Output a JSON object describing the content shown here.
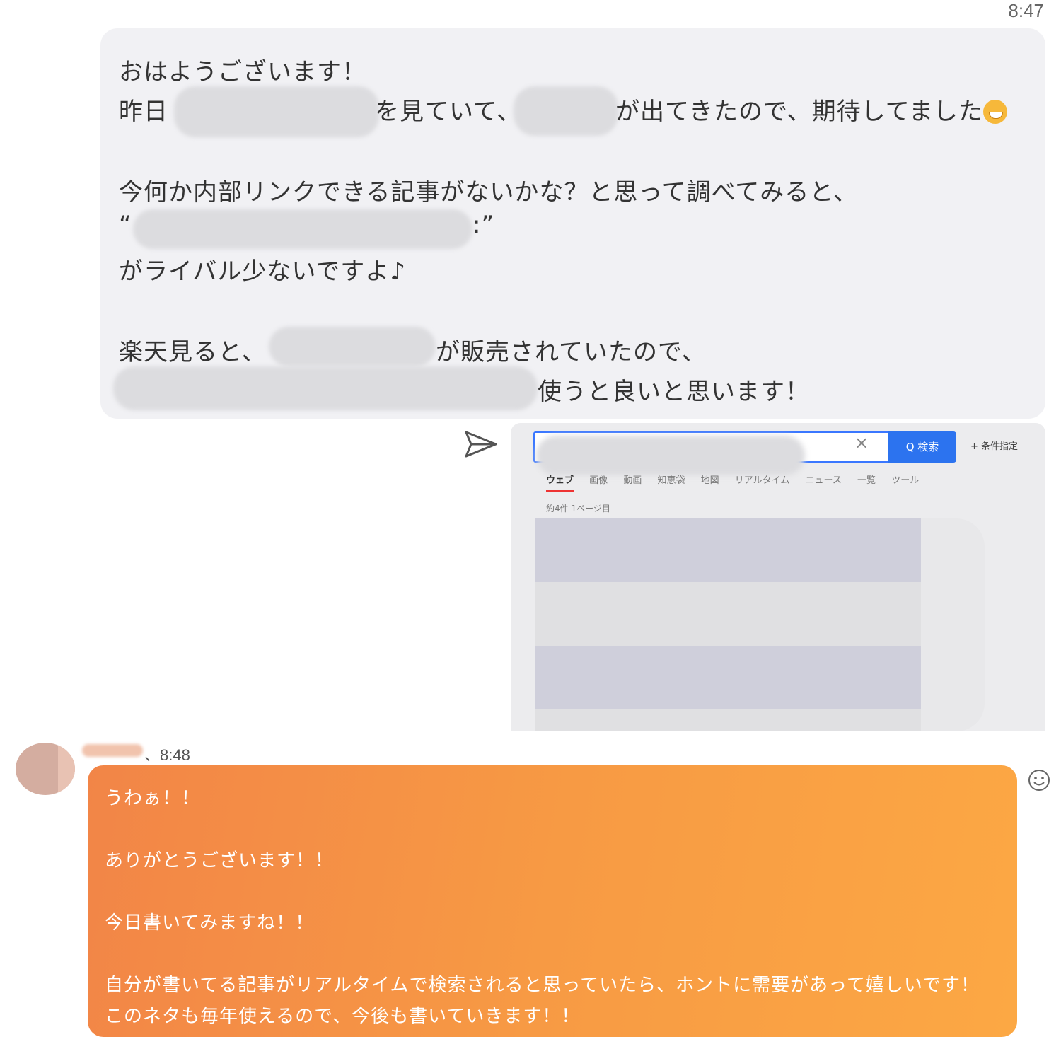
{
  "chat": {
    "incoming": {
      "time": "8:47",
      "lines": {
        "l1": "おはようございます！",
        "l2_a": "昨日",
        "l2_b": "を見ていて、",
        "l2_c": "が出てきたので、期待してました",
        "l3": "今何か内部リンクできる記事がないかな？と思って調べてみると、",
        "l4_open": "“",
        "l4_close": ":”",
        "l5": "がライバル少ないですよ♪",
        "l6_a": "楽天見ると、",
        "l6_b": "が販売されていたので、",
        "l7": "使うと良いと思います！"
      },
      "emoji": "grinning-face-emoji"
    },
    "screenshot": {
      "search_clear": "×",
      "search_button": "Q 検索",
      "condition": "+ 条件指定",
      "tabs": [
        "ウェブ",
        "画像",
        "動画",
        "知恵袋",
        "地図",
        "リアルタイム",
        "ニュース",
        "一覧",
        "ツール"
      ],
      "result_count": "約4件 1ページ目"
    },
    "outgoing": {
      "time": "、8:48",
      "lines": [
        "うわぁ！！",
        "ありがとうございます！！",
        "今日書いてみますね！！",
        "自分が書いてる記事がリアルタイムで検索されると思っていたら、ホントに需要があって嬉しいです！",
        "このネタも毎年使えるので、今後も書いていきます！！"
      ]
    }
  },
  "colors": {
    "incoming_bubble": "#f1f1f4",
    "outgoing_start": "#f28547",
    "outgoing_end": "#fca844",
    "search_blue": "#2c73ef"
  }
}
